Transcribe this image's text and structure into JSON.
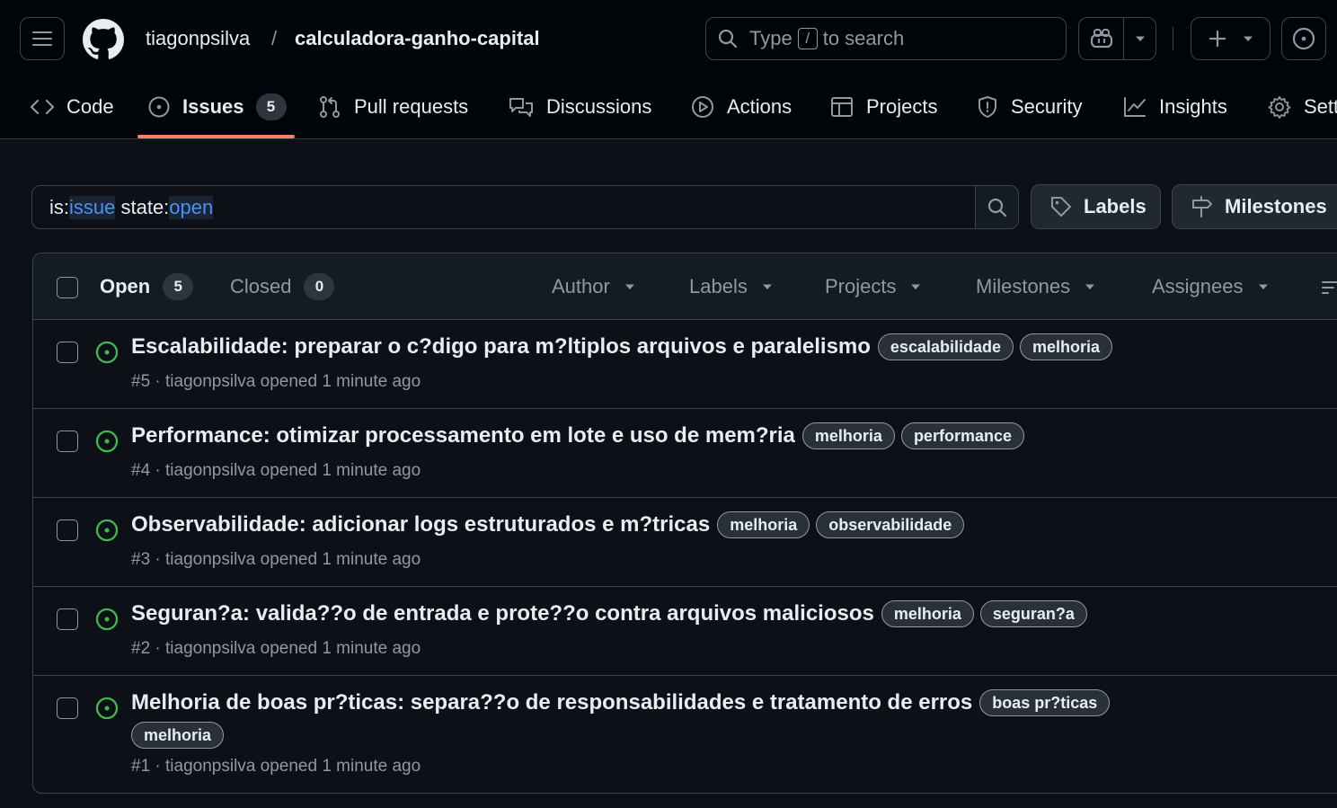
{
  "header": {
    "owner": "tiagonpsilva",
    "separator": "/",
    "repo": "calculadora-ganho-capital",
    "search_prefix": "Type",
    "search_key": "/",
    "search_suffix": "to search"
  },
  "nav": {
    "code": "Code",
    "issues": "Issues",
    "issues_count": "5",
    "pulls": "Pull requests",
    "discussions": "Discussions",
    "actions": "Actions",
    "projects": "Projects",
    "security": "Security",
    "insights": "Insights",
    "settings": "Sett"
  },
  "filter": {
    "is_key": "is:",
    "is_value": "issue",
    "state_key": "state:",
    "state_value": "open",
    "labels_button": "Labels",
    "milestones_button": "Milestones"
  },
  "list_header": {
    "open_label": "Open",
    "open_count": "5",
    "closed_label": "Closed",
    "closed_count": "0",
    "filters": [
      "Author",
      "Labels",
      "Projects",
      "Milestones",
      "Assignees"
    ]
  },
  "issues": [
    {
      "title": "Escalabilidade: preparar o c?digo para m?ltiplos arquivos e paralelismo",
      "labels": [
        "escalabilidade",
        "melhoria"
      ],
      "meta": "#5 · tiagonpsilva opened 1 minute ago"
    },
    {
      "title": "Performance: otimizar processamento em lote e uso de mem?ria",
      "labels": [
        "melhoria",
        "performance"
      ],
      "meta": "#4 · tiagonpsilva opened 1 minute ago"
    },
    {
      "title": "Observabilidade: adicionar logs estruturados e m?tricas",
      "labels": [
        "melhoria",
        "observabilidade"
      ],
      "meta": "#3 · tiagonpsilva opened 1 minute ago"
    },
    {
      "title": "Seguran?a: valida??o de entrada e prote??o contra arquivos maliciosos",
      "labels": [
        "melhoria",
        "seguran?a"
      ],
      "meta": "#2 · tiagonpsilva opened 1 minute ago"
    },
    {
      "title": "Melhoria de boas pr?ticas: separa??o de responsabilidades e tratamento de erros",
      "labels": [
        "boas pr?ticas",
        "melhoria"
      ],
      "meta": "#1 · tiagonpsilva opened 1 minute ago"
    }
  ],
  "colors": {
    "accent_underline": "#f78166",
    "open_icon": "#3fb950",
    "link_highlight": "#4493f8"
  }
}
